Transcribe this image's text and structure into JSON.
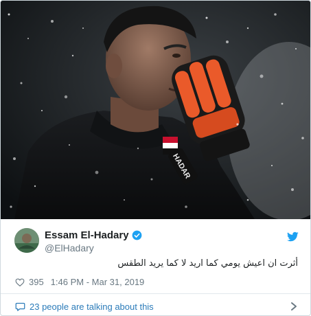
{
  "tweet": {
    "display_name": "Essam El-Hadary",
    "handle": "@ElHadary",
    "text": "أثرت ان اعيش يومي كما اريد لا كما يريد الطقس",
    "likes": "395",
    "timestamp": "1:46 PM - Mar 31, 2019",
    "talking_about": "23 people are talking about this",
    "glove_text": "HADAR"
  },
  "icons": {
    "verified": "verified-badge-icon",
    "bird": "twitter-bird-icon",
    "heart": "heart-icon",
    "comment": "comment-bubble-icon",
    "chevron": "chevron-right-icon"
  },
  "colors": {
    "accent": "#1da1f2",
    "link": "#2b7bb9",
    "muted": "#697882",
    "glove_orange": "#ea5a2a"
  }
}
